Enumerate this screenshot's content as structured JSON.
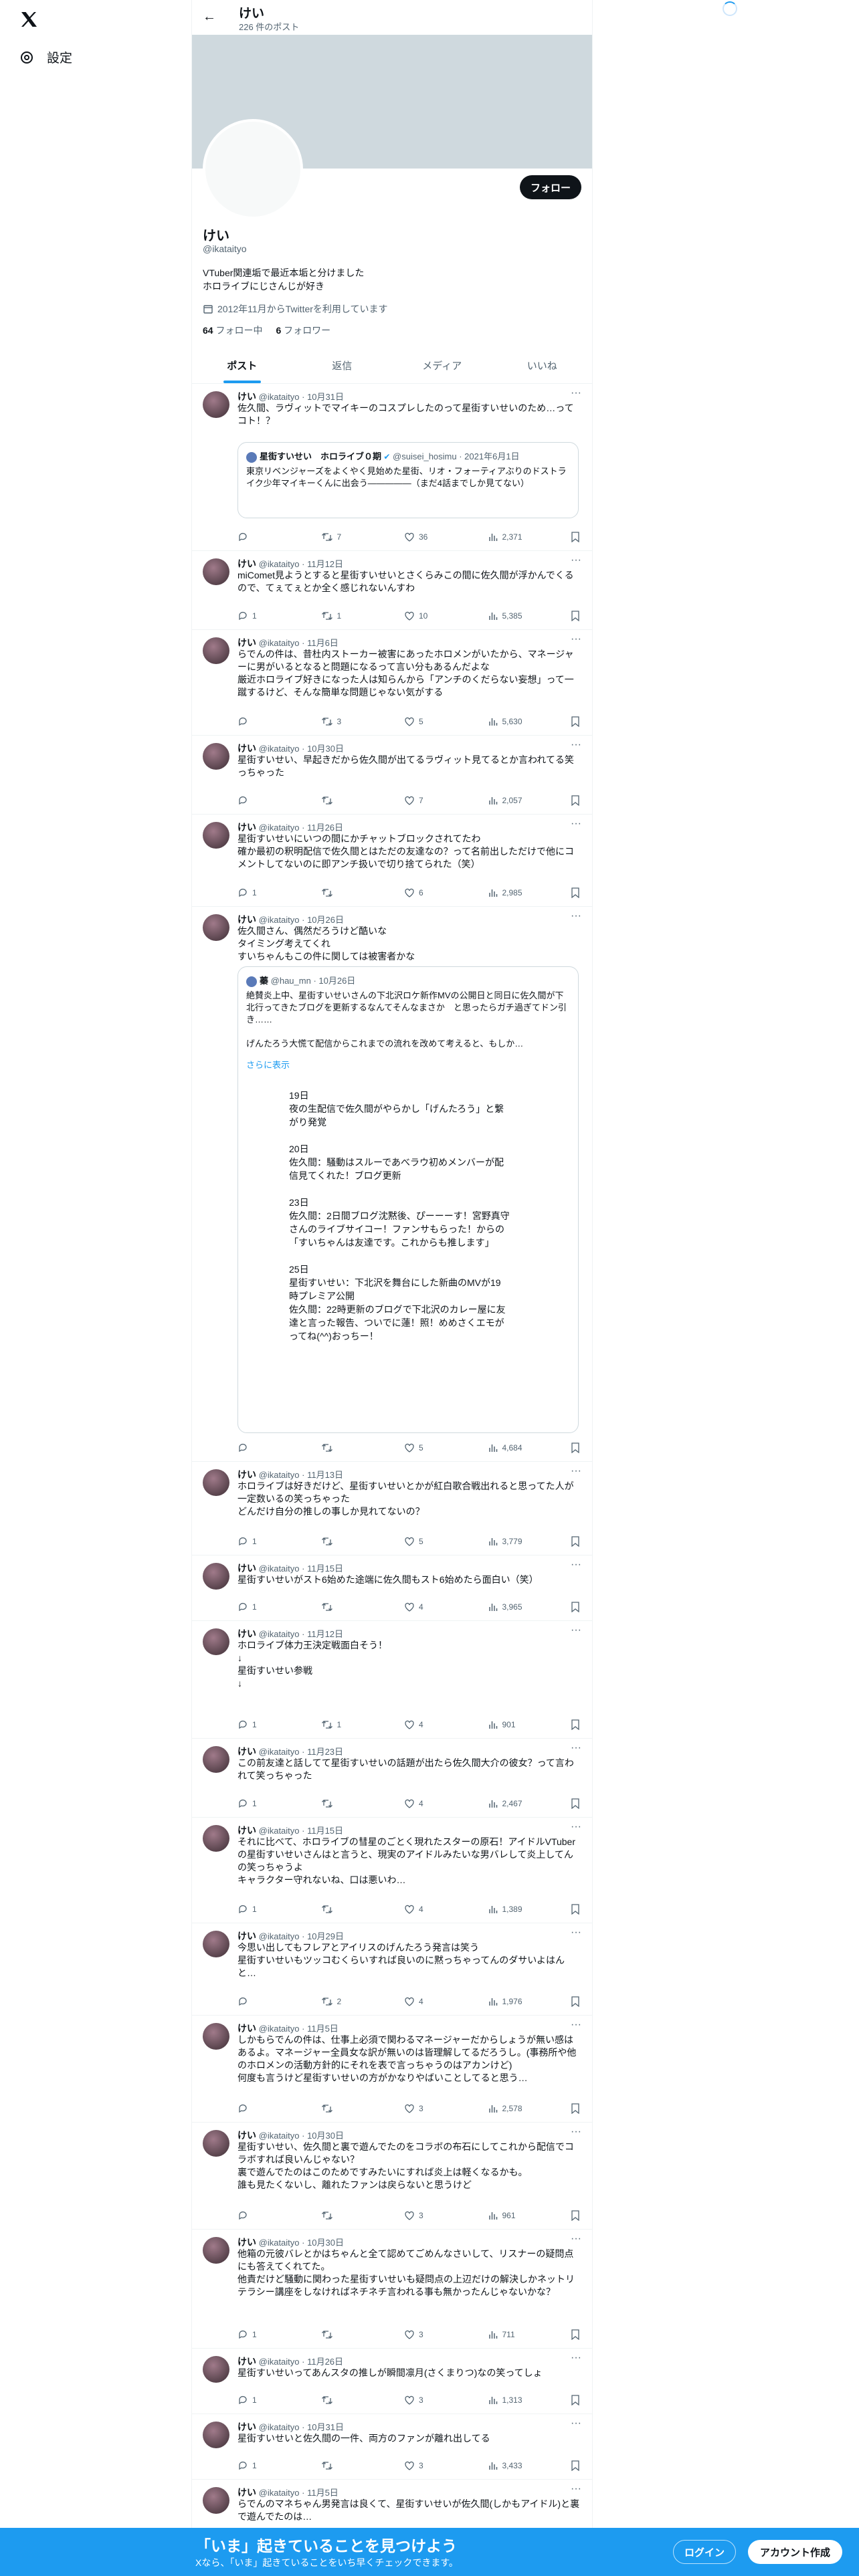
{
  "nav": {
    "settings_label": "設定"
  },
  "header": {
    "title": "けい",
    "post_count": "226 件のポスト"
  },
  "profile": {
    "follow_label": "フォロー",
    "name": "けい",
    "handle": "@ikataityo",
    "bio": "VTuber関連垢で最近本垢と分けました\nホロライブにじさんじが好き",
    "joined": "2012年11月からTwitterを利用しています",
    "following_count": "64",
    "following_label": "フォロー中",
    "followers_count": "6",
    "followers_label": "フォロワー"
  },
  "tabs": [
    {
      "label": "ポスト"
    },
    {
      "label": "返信"
    },
    {
      "label": "メディア"
    },
    {
      "label": "いいね"
    }
  ],
  "tweets": [
    {
      "name": "けい",
      "handle": "@ikataityo",
      "date": "10月31日",
      "text": "佐久間、ラヴィットでマイキーのコスプレしたのって星街すいせいのため…ってコト！？",
      "reply": "",
      "rt": "7",
      "like": "36",
      "views": "2,371",
      "quote": {
        "name": "星街すいせい　ホロライブ０期",
        "handle": "@suisei_hosimu",
        "date": "2021年6月1日",
        "text": "東京リベンジャーズをよくやく見始めた星街、リオ・フォーティアぶりのドストライク少年マイキーくんに出会う―――――（まだ4話までしか見てない）"
      }
    },
    {
      "name": "けい",
      "handle": "@ikataityo",
      "date": "11月12日",
      "text": "miComet見ようとすると星街すいせいとさくらみこの間に佐久間が浮かんでくるので、てぇてぇとか全く感じれないんすわ",
      "reply": "1",
      "rt": "1",
      "like": "10",
      "views": "5,385"
    },
    {
      "name": "けい",
      "handle": "@ikataityo",
      "date": "11月6日",
      "text": "らでんの件は、昔杜内ストーカー被害にあったホロメンがいたから、マネージャーに男がいるとなると問題になるって言い分もあるんだよな\n厳近ホロライブ好きになった人は知らんから「アンチのくだらない妄想」って一蹴するけど、そんな簡単な問題じゃない気がする",
      "reply": "",
      "rt": "3",
      "like": "5",
      "views": "5,630"
    },
    {
      "name": "けい",
      "handle": "@ikataityo",
      "date": "10月30日",
      "text": "星街すいせい、早起きだから佐久間が出てるラヴィット見てるとか言われてる笑っちゃった",
      "reply": "",
      "rt": "",
      "like": "7",
      "views": "2,057"
    },
    {
      "name": "けい",
      "handle": "@ikataityo",
      "date": "11月26日",
      "text": "星街すいせいにいつの間にかチャットブロックされてたわ\n確か最初の釈明配信で佐久間とはただの友達なの？って名前出しただけで他にコメントしてないのに即アンチ扱いで切り捨てられた（笑）",
      "reply": "1",
      "rt": "",
      "like": "6",
      "views": "2,985"
    },
    {
      "name": "けい",
      "handle": "@ikataityo",
      "date": "10月26日",
      "text": "佐久間さん、偶然だろうけど酷いな\nタイミング考えてくれ\nすいちゃんもこの件に関しては被害者かな",
      "reply": "",
      "rt": "",
      "like": "5",
      "views": "4,684",
      "quote": {
        "name": "蓁",
        "handle": "@hau_mn",
        "date": "10月26日",
        "text": "絶賛炎上中、星街すいせいさんの下北沢ロケ新作MVの公開日と同日に佐久間が下北行ってきたブログを更新するなんてそんなまさか　と思ったらガチ過ぎてドン引き……\n\nげんたろう大慌て配信からこれまでの流れを改めて考えると、もしか…",
        "more": "さらに表示",
        "timeline": "19日\n夜の生配信で佐久間がやらかし「げんたろう」と繋がり発覚\n\n20日\n佐久間：騒動はスルーであべラウ初めメンバーが配信見てくれた！ブログ更新\n\n23日\n佐久間：2日間ブログ沈黙後、ぴーーーす！宮野真守さんのライブサイコー！ファンサもらった！からの「すいちゃんは友達です。これからも推します」\n\n25日\n星街すいせい：下北沢を舞台にした新曲のMVが19時プレミア公開\n佐久間：22時更新のブログで下北沢のカレー屋に友達と言った報告、ついでに蓮！照！めめさくエモがってね(^^)おっちー！"
      }
    },
    {
      "name": "けい",
      "handle": "@ikataityo",
      "date": "11月13日",
      "text": "ホロライブは好きだけど、星街すいせいとかが紅白歌合戦出れると思ってた人が一定数いるの笑っちゃった\nどんだけ自分の推しの事しか見れてないの？",
      "reply": "1",
      "rt": "",
      "like": "5",
      "views": "3,779"
    },
    {
      "name": "けい",
      "handle": "@ikataityo",
      "date": "11月15日",
      "text": "星街すいせいがスト6始めた途端に佐久間もスト6始めたら面白い（笑）",
      "reply": "1",
      "rt": "",
      "like": "4",
      "views": "3,965"
    },
    {
      "name": "けい",
      "handle": "@ikataityo",
      "date": "11月12日",
      "text": "ホロライブ体力王決定戦面白そう！\n↓\n星街すいせい参戦\n↓",
      "reply": "1",
      "rt": "1",
      "like": "4",
      "views": "901"
    },
    {
      "name": "けい",
      "handle": "@ikataityo",
      "date": "11月23日",
      "text": "この前友達と話してて星街すいせいの話題が出たら佐久間大介の彼女？って言われて笑っちゃった",
      "reply": "1",
      "rt": "",
      "like": "4",
      "views": "2,467"
    },
    {
      "name": "けい",
      "handle": "@ikataityo",
      "date": "11月15日",
      "text": "それに比べて、ホロライブの彗星のごとく現れたスターの原石！アイドルVTuberの星街すいせいさんはと言うと、現実のアイドルみたいな男バレして炎上してんの笑っちゃうよ\nキャラクター守れないね、口は悪いわ…",
      "reply": "1",
      "rt": "",
      "like": "4",
      "views": "1,389"
    },
    {
      "name": "けい",
      "handle": "@ikataityo",
      "date": "10月29日",
      "text": "今思い出してもフレアとアイリスのげんたろう発言は笑う\n星街すいせいもツッコむくらいすれば良いのに黙っちゃってんのダサいよはんと…",
      "reply": "",
      "rt": "2",
      "like": "4",
      "views": "1,976"
    },
    {
      "name": "けい",
      "handle": "@ikataityo",
      "date": "11月5日",
      "text": "しかもらでんの件は、仕事上必須で関わるマネージャーだからしょうが無い感はあるよ。マネージャー全員女な訳が無いのは皆理解してるだろうし。(事務所や他のホロメンの活動方針的にそれを表で言っちゃうのはアカンけど)\n何度も言うけど星街すいせいの方がかなりやばいことしてると思う…",
      "reply": "",
      "rt": "",
      "like": "3",
      "views": "2,578"
    },
    {
      "name": "けい",
      "handle": "@ikataityo",
      "date": "10月30日",
      "text": "星街すいせい、佐久間と裏で遊んでたのをコラボの布石にしてこれから配信でコラボすれば良いんじゃない？\n裏で遊んでたのはこのためですみたいにすれば炎上は軽くなるかも。\n誰も見たくないし、離れたファンは戻らないと思うけど",
      "reply": "",
      "rt": "",
      "like": "3",
      "views": "961"
    },
    {
      "name": "けい",
      "handle": "@ikataityo",
      "date": "10月30日",
      "text": "他箱の元彼バレとかはちゃんと全て認めてごめんなさいして、リスナーの疑問点にも答えてくれてた。\n他責だけど騒動に関わった星街すいせいも疑問点の上辺だけの解決しかネットリテラシー講座をしなければネチネチ言われる事も無かったんじゃないかな？",
      "reply": "1",
      "rt": "",
      "like": "3",
      "views": "711"
    },
    {
      "name": "けい",
      "handle": "@ikataityo",
      "date": "11月26日",
      "text": "星街すいせいってあんスタの推しが瞬間凛月(さくまりつ)なの笑ってしょ",
      "reply": "1",
      "rt": "",
      "like": "3",
      "views": "1,313"
    },
    {
      "name": "けい",
      "handle": "@ikataityo",
      "date": "10月31日",
      "text": "星街すいせいと佐久間の一件、両方のファンが離れ出してる",
      "reply": "1",
      "rt": "",
      "like": "3",
      "views": "3,433"
    },
    {
      "name": "けい",
      "handle": "@ikataityo",
      "date": "11月5日",
      "text": "らでんのマネちゃん男発言は良くて、星街すいせいが佐久間(しかもアイドル)と裏で遊んでたのは…",
      "reply": "",
      "rt": "",
      "like": "",
      "views": ""
    }
  ],
  "bottom_bar": {
    "title": "「いま」起きていることを見つけよう",
    "subtitle": "Xなら、「いま」起きていることをいち早くチェックできます。",
    "login_label": "ログイン",
    "signup_label": "アカウント作成"
  }
}
